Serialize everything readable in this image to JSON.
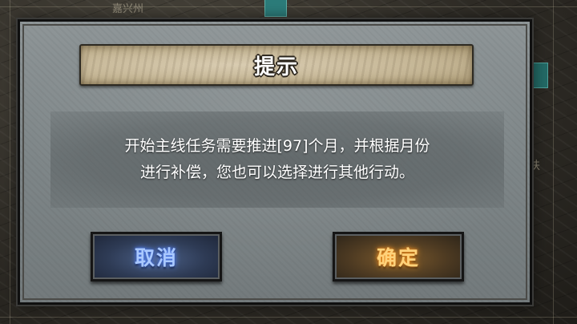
{
  "background": {
    "map_label_top": "嘉兴州",
    "map_label_side": "扶"
  },
  "dialog": {
    "title": "提示",
    "message_line1": "开始主线任务需要推进[97]个月，并根据月份",
    "message_line2": "进行补偿，您也可以选择进行其他行动。",
    "cancel_label": "取消",
    "confirm_label": "确定"
  },
  "colors": {
    "cancel_glow": "#5f8fff",
    "confirm_glow": "#ff9f2a",
    "title_plaque": "#c4b594",
    "dialog_panel": "#7e8688"
  }
}
